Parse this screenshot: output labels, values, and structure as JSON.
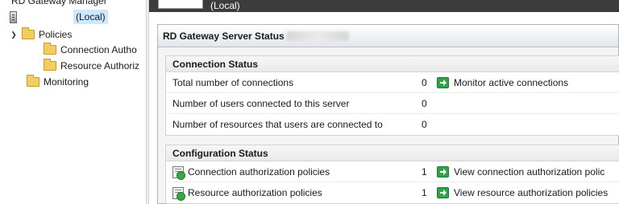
{
  "tree": {
    "root_label": "RD Gateway Manager",
    "server_label": "(Local)",
    "policies_label": "Policies",
    "connection_auth_label": "Connection Autho",
    "resource_auth_label": "Resource Authoriz",
    "monitoring_label": "Monitoring"
  },
  "header": {
    "title": "(Local)"
  },
  "panel": {
    "title": "RD Gateway Server Status"
  },
  "connection_status": {
    "heading": "Connection Status",
    "rows": [
      {
        "label": "Total number of connections",
        "count": "0",
        "action": "Monitor active connections"
      },
      {
        "label": "Number of users connected to this server",
        "count": "0"
      },
      {
        "label": "Number of resources that users are connected to",
        "count": "0"
      }
    ]
  },
  "configuration_status": {
    "heading": "Configuration Status",
    "rows": [
      {
        "label": "Connection authorization policies",
        "count": "1",
        "action": "View connection authorization polic"
      },
      {
        "label": "Resource authorization policies",
        "count": "1",
        "action": "View resource authorization policies"
      }
    ]
  },
  "colors": {
    "selection": "#cce8ff",
    "topbar": "#3c3c3c",
    "go_icon": "#2fa347",
    "folder": "#f3cd5e"
  },
  "icons": [
    "server-icon",
    "folder-icon",
    "chevron-down-icon",
    "go-arrow-icon",
    "policy-icon"
  ]
}
